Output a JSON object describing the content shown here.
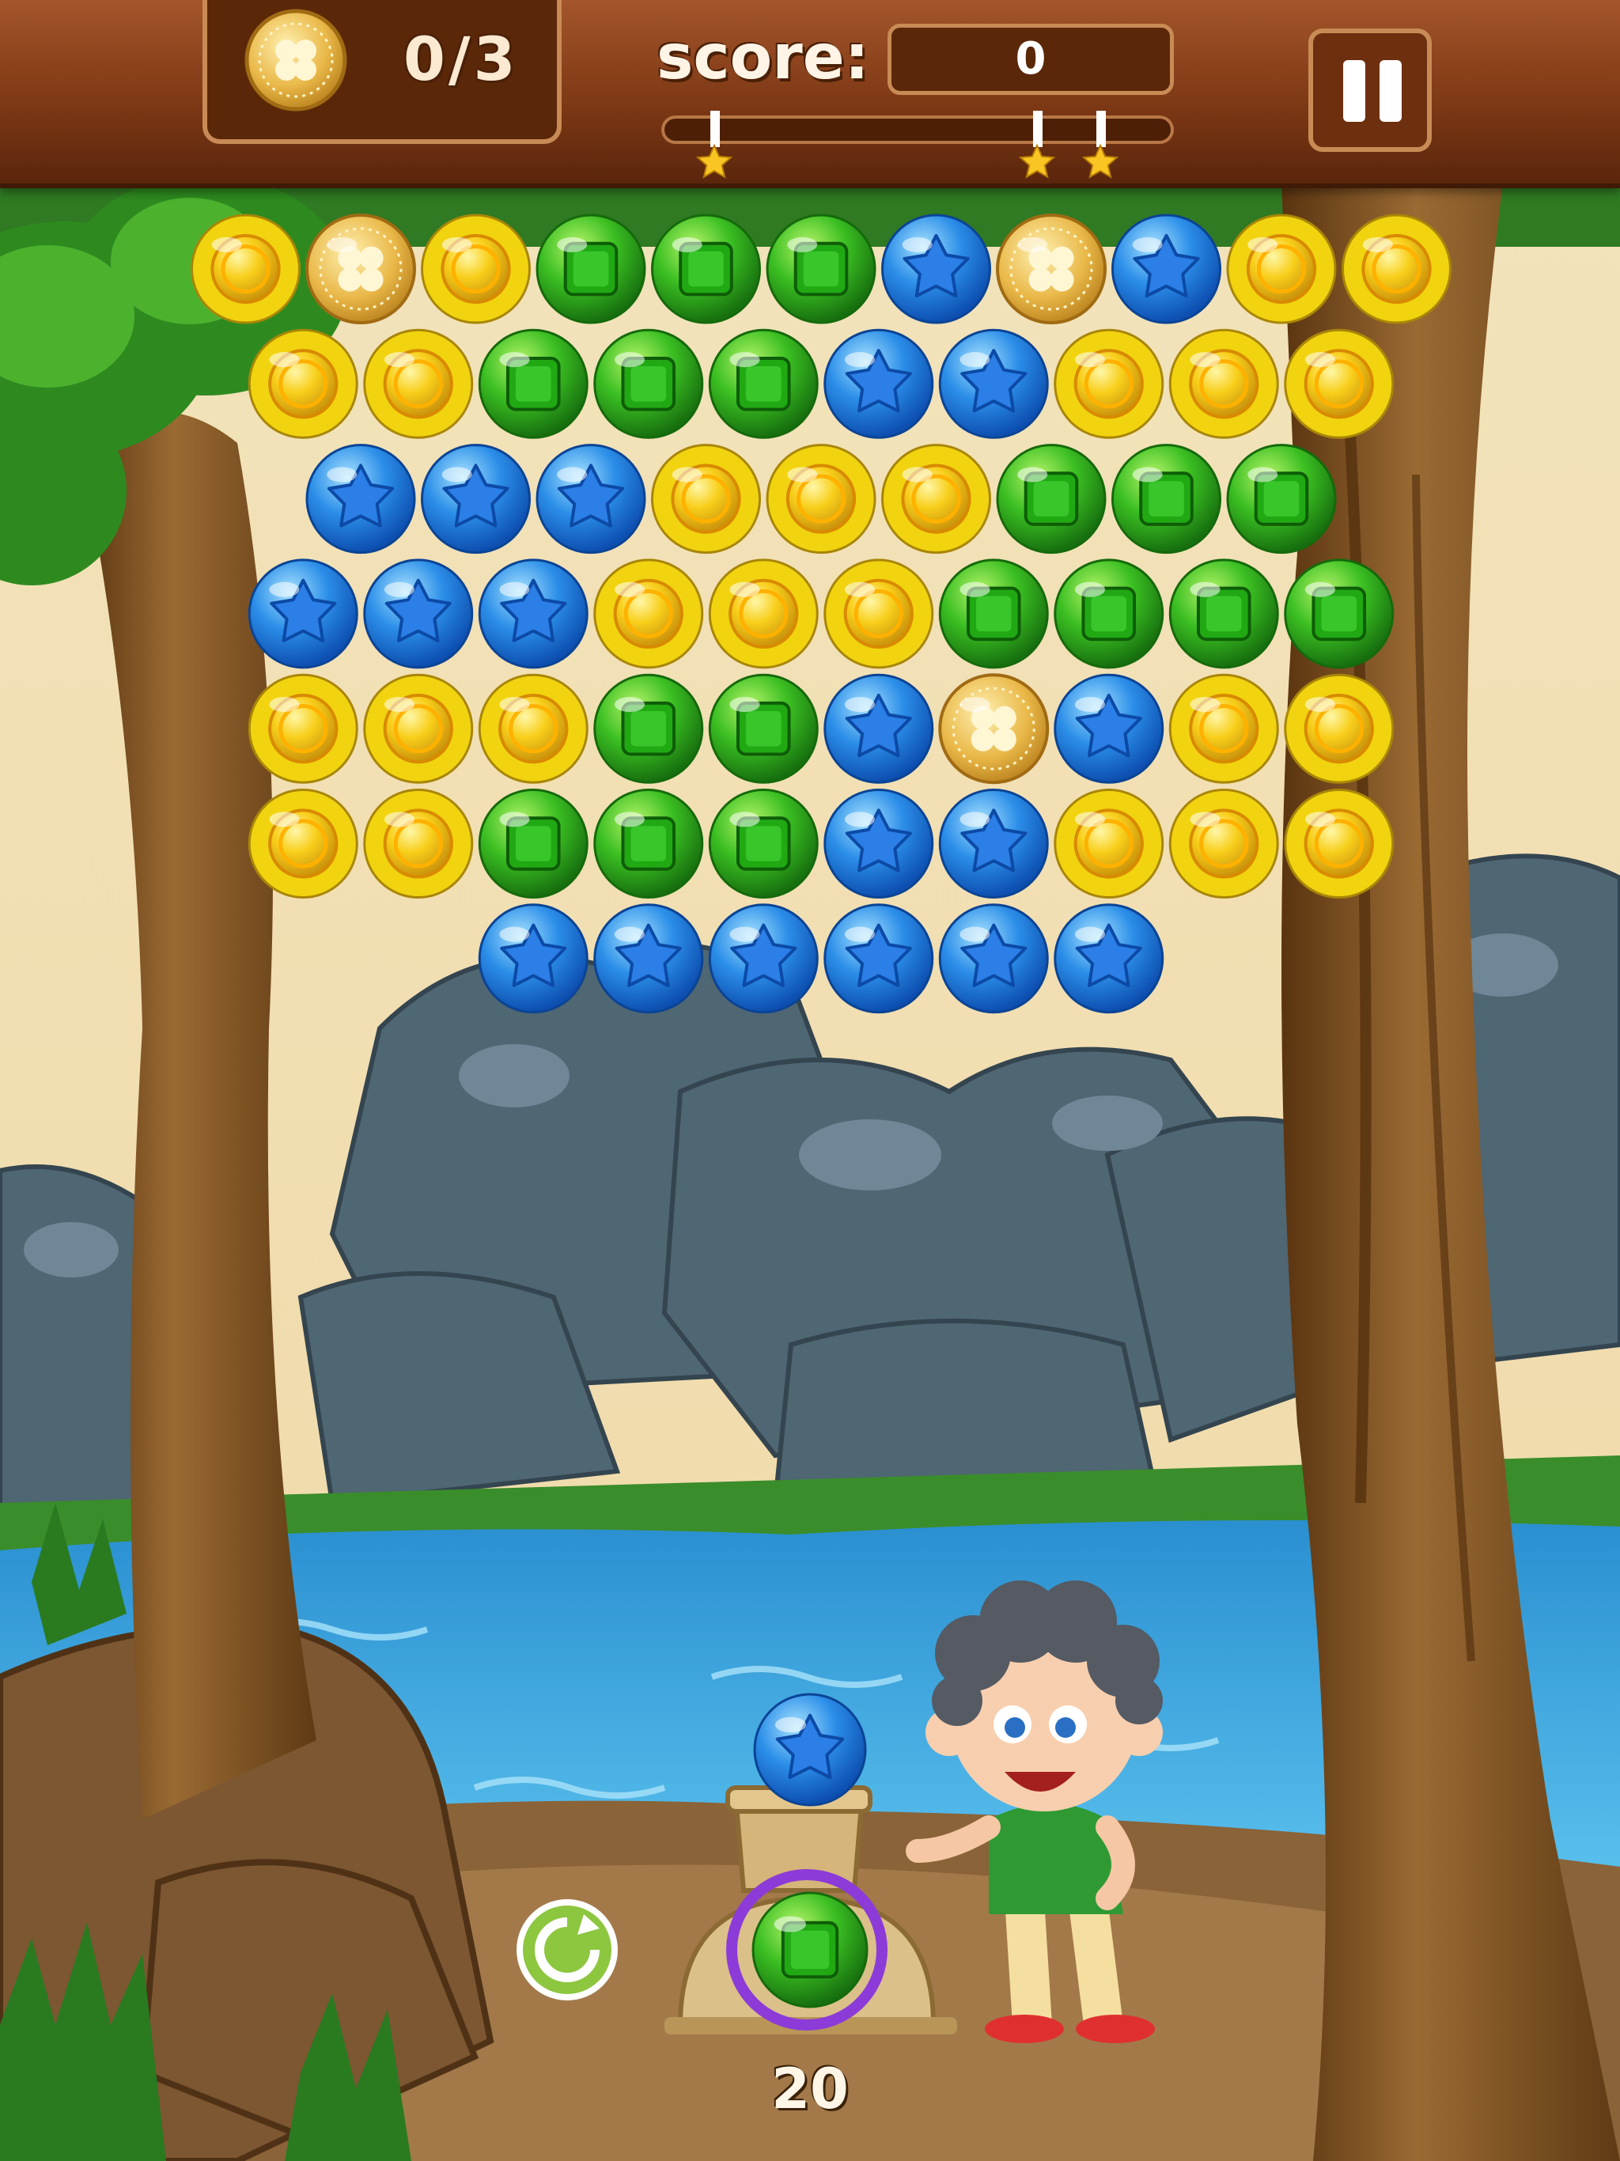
{
  "hud": {
    "coins_collected": "0/3",
    "score_label": "score:",
    "score_value": "0",
    "progress_fraction": 0,
    "progress_star_count": 3,
    "pause_icon": "pause-icon"
  },
  "board": {
    "legend": {
      "y": "gold-coin-bubble",
      "g": "green-square-bubble",
      "b": "blue-star-bubble",
      "c": "clover-coin-bubble"
    },
    "rows": [
      "ycygggbcbyy",
      "yygggbbyyy",
      "bbbyyyggg",
      "bbbyyygggg",
      "yyyggbcbyy",
      "yygggbbyyy",
      "bbbbbb"
    ]
  },
  "shooter": {
    "loaded_bubble": "blue-star-bubble",
    "next_bubble": "green-square-bubble",
    "moves_left": "20",
    "swap_icon": "rotate-arrow-icon"
  },
  "colors": {
    "gold": "#f6b800",
    "green": "#2fa51f",
    "blue": "#1f7fe0",
    "hud_brown": "#7b3714",
    "sky": "#f1e2bd",
    "water": "#2f9ed8"
  }
}
